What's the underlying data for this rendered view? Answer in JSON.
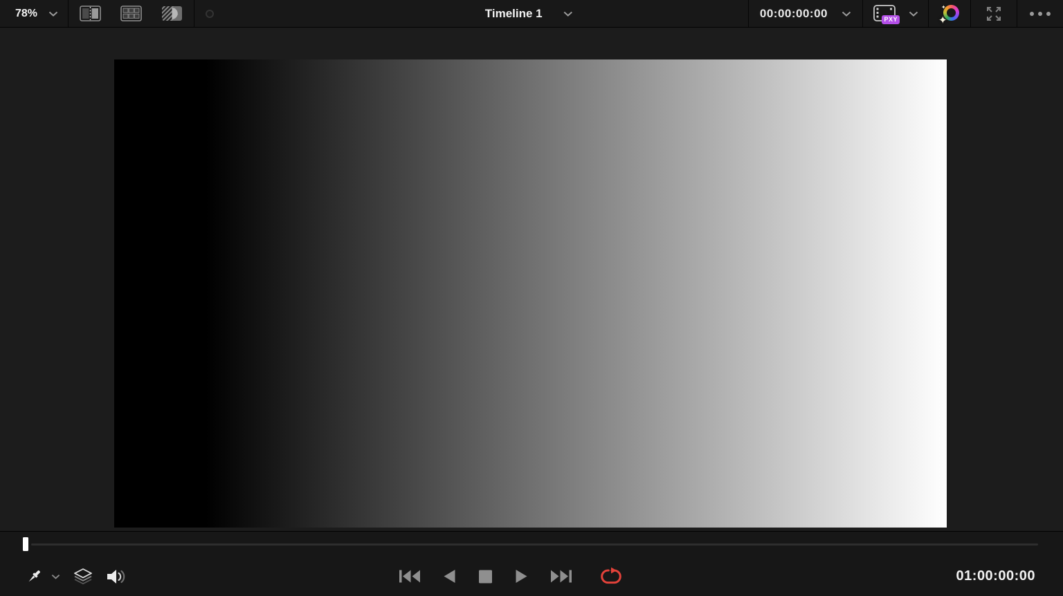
{
  "top_bar": {
    "zoom_level": "78%",
    "timeline_name": "Timeline 1",
    "timecode": "00:00:00:00",
    "proxy_badge_label": "PXY"
  },
  "viewer": {
    "canvas": {
      "type": "grayscale-gradient",
      "direction": "left-to-right",
      "from_color": "#000000",
      "to_color": "#ffffff"
    }
  },
  "transport": {
    "playhead_timecode": "01:00:00:00",
    "playhead_position": "start"
  },
  "icons": {
    "chevron_glyph": "⌄",
    "sparkle_glyph": "✦",
    "ellipsis_glyph": "•••",
    "split-screen-icon": "dual-pane rect with dotted divider",
    "multi-view-grid-icon": "2x3 grid in rect",
    "wipe-compare-icon": "hatched half + half-disc",
    "status-dot": "small dark ring",
    "proxy-media-icon": "film clip with PXY badge",
    "color-boost-icon": "rainbow ring with sparkles",
    "expand-icon": "four outward corner arrows",
    "eyedropper-icon": "diagonal color picker",
    "layers-icon": "three stacked diamonds",
    "volume-icon": "speaker with sound waves",
    "skip-to-start-icon": "bar + double left triangles",
    "play-reverse-icon": "left triangle",
    "stop-icon": "square",
    "play-icon": "right triangle",
    "skip-to-end-icon": "double right triangles + bar",
    "loop-icon": "red rounded repeat arrow"
  },
  "colors": {
    "proxy_badge": "#b44fe8",
    "loop_button": "#e2423a",
    "transport_icon": "#8f8f8f",
    "playhead": "#ffffff",
    "panel_background": "#171717"
  }
}
